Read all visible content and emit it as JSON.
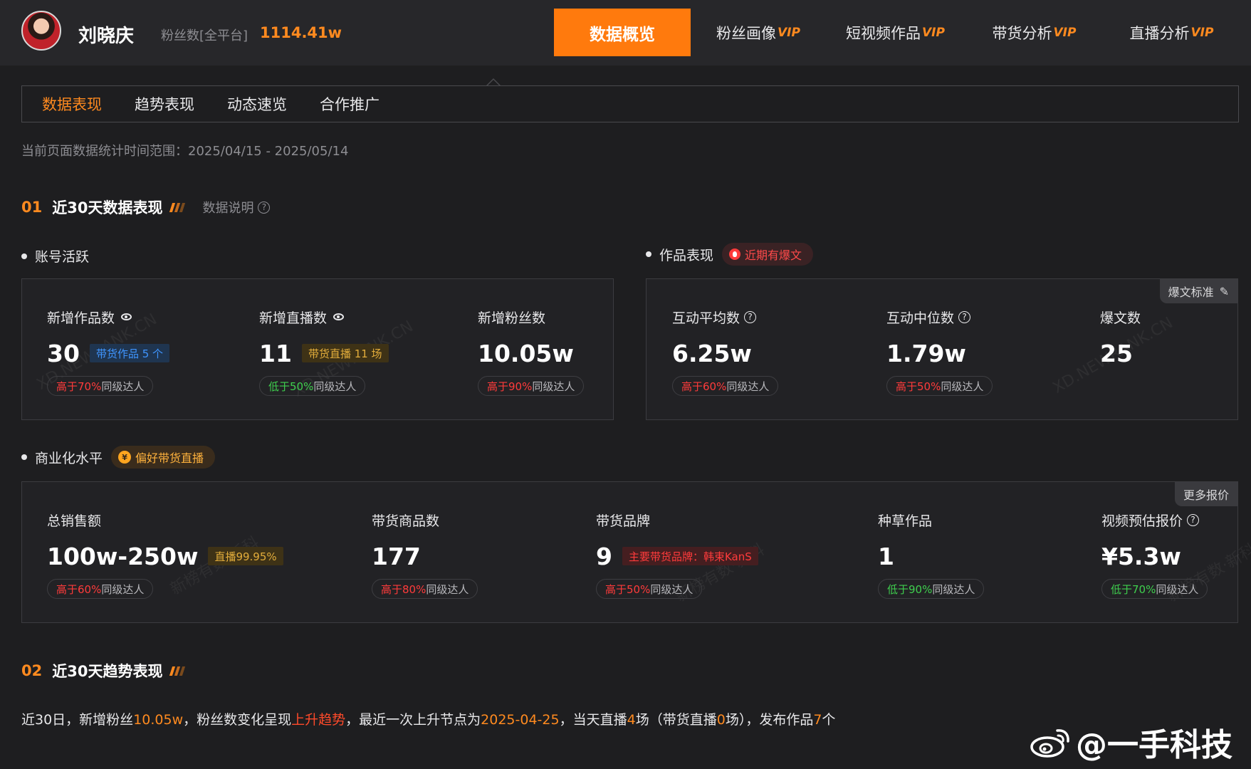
{
  "header": {
    "username": "刘晓庆",
    "fans_label": "粉丝数[全平台]",
    "fans_value": "1114.41w",
    "nav": [
      {
        "label": "数据概览",
        "vip": ""
      },
      {
        "label": "粉丝画像",
        "vip": "VIP"
      },
      {
        "label": "短视频作品",
        "vip": "VIP"
      },
      {
        "label": "带货分析",
        "vip": "VIP"
      },
      {
        "label": "直播分析",
        "vip": "VIP"
      }
    ]
  },
  "subtabs": [
    "数据表现",
    "趋势表现",
    "动态速览",
    "合作推广"
  ],
  "date_range": "当前页面数据统计时间范围：2025/04/15 - 2025/05/14",
  "section1": {
    "num": "01",
    "title": "近30天数据表现",
    "desc": "数据说明"
  },
  "account": {
    "label": "账号活跃",
    "metrics": [
      {
        "label": "新增作品数",
        "value": "30",
        "tag": "带货作品 5 个",
        "cmp_hl": "高于70%",
        "cmp_rest": "同级达人"
      },
      {
        "label": "新增直播数",
        "value": "11",
        "tag": "带货直播 11 场",
        "cmp_hl": "低于50%",
        "cmp_rest": "同级达人"
      },
      {
        "label": "新增粉丝数",
        "value": "10.05w",
        "cmp_hl": "高于90%",
        "cmp_rest": "同级达人"
      }
    ]
  },
  "works": {
    "label": "作品表现",
    "badge": "近期有爆文",
    "corner": "爆文标准",
    "metrics": [
      {
        "label": "互动平均数",
        "value": "6.25w",
        "cmp_hl": "高于60%",
        "cmp_rest": "同级达人"
      },
      {
        "label": "互动中位数",
        "value": "1.79w",
        "cmp_hl": "高于50%",
        "cmp_rest": "同级达人"
      },
      {
        "label": "爆文数",
        "value": "25"
      }
    ]
  },
  "commerce": {
    "label": "商业化水平",
    "badge": "偏好带货直播",
    "corner": "更多报价",
    "metrics": [
      {
        "label": "总销售额",
        "value": "100w-250w",
        "tag": "直播99.95%",
        "cmp_hl": "高于60%",
        "cmp_rest": "同级达人"
      },
      {
        "label": "带货商品数",
        "value": "177",
        "cmp_hl": "高于80%",
        "cmp_rest": "同级达人"
      },
      {
        "label": "带货品牌",
        "value": "9",
        "tag": "主要带货品牌：韩束KanS",
        "cmp_hl": "高于50%",
        "cmp_rest": "同级达人"
      },
      {
        "label": "种草作品",
        "value": "1",
        "cmp_hl": "低于90%",
        "cmp_rest": "同级达人"
      },
      {
        "label": "视频预估报价",
        "value": "¥5.3w",
        "cmp_hl": "低于70%",
        "cmp_rest": "同级达人"
      }
    ]
  },
  "section2": {
    "num": "02",
    "title": "近30天趋势表现"
  },
  "summary": {
    "p1": "近30日，新增粉丝",
    "fans": "10.05w",
    "p2": "，粉丝数变化呈现",
    "trend": "上升趋势",
    "p3": "，最近一次上升节点为",
    "date": "2025-04-25",
    "p4": "，当天直播",
    "live": "4",
    "p5": "场（带货直播",
    "sale_live": "0",
    "p6": "场），发布作品",
    "works": "7",
    "p7": "个"
  },
  "watermarks": {
    "site": "XD.NEWRANK.CN",
    "brand": "新榜有数·新科"
  },
  "weibo": "@一手科技",
  "colors": {
    "accent": "#ff7a0d",
    "up": "#ff3b3b",
    "down": "#3fcf4e",
    "bg": "#1e1e20"
  }
}
